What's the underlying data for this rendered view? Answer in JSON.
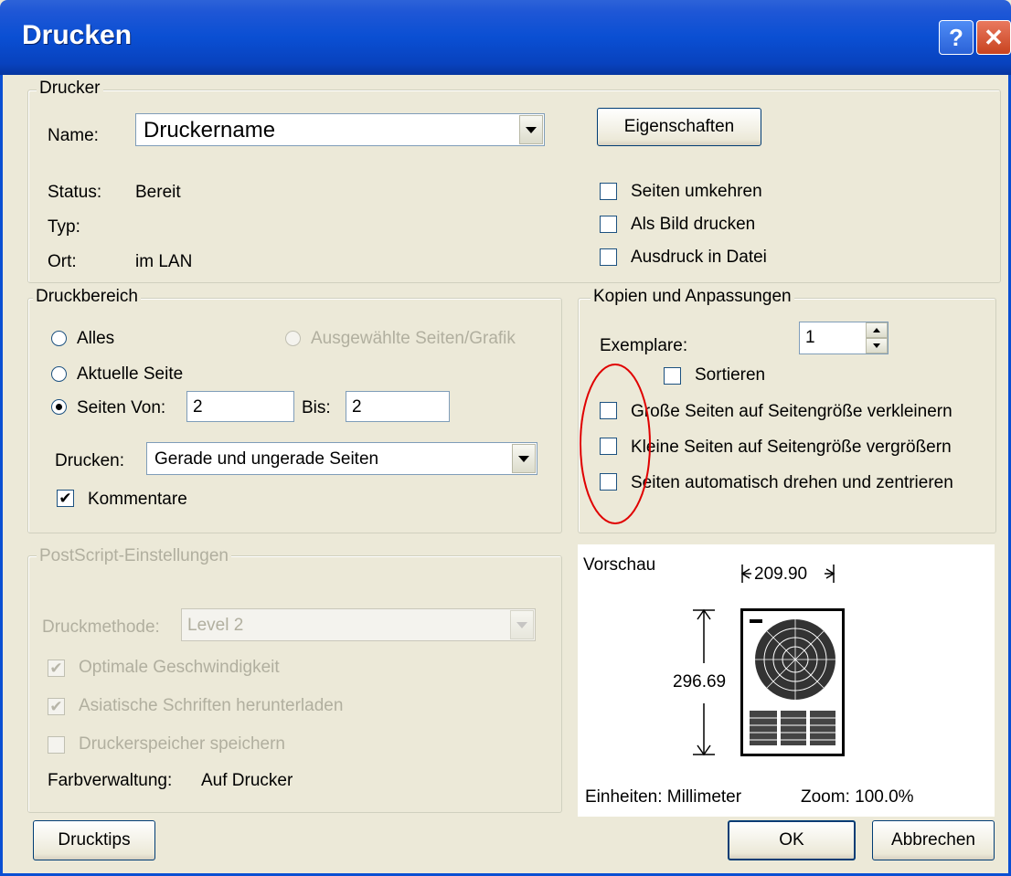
{
  "window": {
    "title": "Drucken",
    "help_label": "?",
    "close_label": "✕"
  },
  "drucker": {
    "legend": "Drucker",
    "name_label": "Name:",
    "name_value": "Druckername",
    "properties_button": "Eigenschaften",
    "status_label": "Status:",
    "status_value": "Bereit",
    "typ_label": "Typ:",
    "typ_value": "",
    "ort_label": "Ort:",
    "ort_value": "im LAN",
    "options": [
      {
        "label": "Seiten umkehren",
        "checked": false
      },
      {
        "label": "Als Bild drucken",
        "checked": false
      },
      {
        "label": "Ausdruck in Datei",
        "checked": false
      }
    ]
  },
  "druckbereich": {
    "legend": "Druckbereich",
    "radio_alles": "Alles",
    "radio_selection": "Ausgewählte Seiten/Grafik",
    "radio_current": "Aktuelle Seite",
    "radio_pages": "Seiten Von:",
    "von_value": "2",
    "bis_label": "Bis:",
    "bis_value": "2",
    "drucken_label": "Drucken:",
    "drucken_value": "Gerade und ungerade Seiten",
    "kommentare_label": "Kommentare",
    "kommentare_checked": true
  },
  "kopien": {
    "legend": "Kopien und Anpassungen",
    "exemplare_label": "Exemplare:",
    "exemplare_value": "1",
    "sortieren_label": "Sortieren",
    "options": [
      {
        "label": "Große Seiten auf Seitengröße verkleinern",
        "checked": false
      },
      {
        "label": "Kleine Seiten auf Seitengröße vergrößern",
        "checked": false
      },
      {
        "label": "Seiten automatisch drehen und zentrieren",
        "checked": false
      }
    ],
    "highlight_color": "#e00000"
  },
  "postscript": {
    "legend": "PostScript-Einstellungen",
    "method_label": "Druckmethode:",
    "method_value": "Level 2",
    "opt_speed": "Optimale Geschwindigkeit",
    "opt_fonts": "Asiatische Schriften herunterladen",
    "opt_memory": "Druckerspeicher speichern",
    "farb_label": "Farbverwaltung:",
    "farb_value": "Auf Drucker"
  },
  "preview": {
    "title": "Vorschau",
    "width_value": "209.90",
    "height_value": "296.69",
    "units": "Einheiten: Millimeter",
    "zoom": "Zoom: 100.0%"
  },
  "buttons": {
    "tips": "Drucktips",
    "ok": "OK",
    "cancel": "Abbrechen"
  },
  "colors": {
    "titlebar": "#0a4fd3",
    "dialog_bg": "#ece9d8"
  }
}
